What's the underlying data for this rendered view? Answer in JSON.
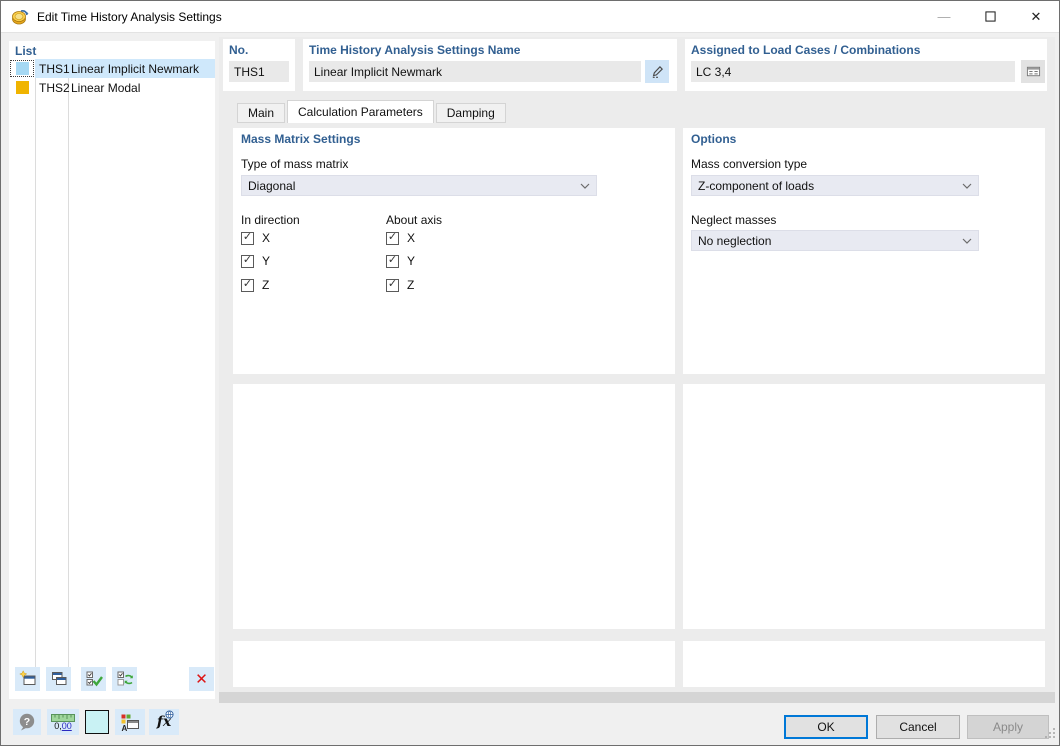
{
  "titlebar": {
    "title": "Edit Time History Analysis Settings",
    "minimize_icon": "—",
    "close_icon": "✕"
  },
  "list": {
    "header": "List",
    "items": [
      {
        "id": "THS1",
        "name": "Linear Implicit Newmark",
        "color": "#a5d8f3",
        "selected": true
      },
      {
        "id": "THS2",
        "name": "Linear Modal",
        "color": "#f0b400",
        "selected": false
      }
    ],
    "delete_icon": "✕"
  },
  "header_fields": {
    "no": {
      "label": "No.",
      "value": "THS1"
    },
    "name": {
      "label": "Time History Analysis Settings Name",
      "value": "Linear Implicit Newmark"
    },
    "assigned": {
      "label": "Assigned to Load Cases / Combinations",
      "value": "LC 3,4"
    }
  },
  "tabs": [
    {
      "label": "Main",
      "active": false
    },
    {
      "label": "Calculation Parameters",
      "active": true
    },
    {
      "label": "Damping",
      "active": false
    }
  ],
  "mass_matrix": {
    "header": "Mass Matrix Settings",
    "type_label": "Type of mass matrix",
    "type_value": "Diagonal",
    "in_direction": {
      "label": "In direction",
      "options": [
        {
          "label": "X",
          "checked": true
        },
        {
          "label": "Y",
          "checked": true
        },
        {
          "label": "Z",
          "checked": true
        }
      ]
    },
    "about_axis": {
      "label": "About axis",
      "options": [
        {
          "label": "X",
          "checked": true
        },
        {
          "label": "Y",
          "checked": true
        },
        {
          "label": "Z",
          "checked": true
        }
      ]
    }
  },
  "options_panel": {
    "header": "Options",
    "conversion_label": "Mass conversion type",
    "conversion_value": "Z-component of loads",
    "neglect_label": "Neglect masses",
    "neglect_value": "No neglection"
  },
  "footer": {
    "help_icon": "?",
    "decimal_prefix": "0,",
    "decimal_suffix": "00",
    "swatch_color": "#c9f2f4",
    "formula_icon": "fx",
    "ok": "OK",
    "cancel": "Cancel",
    "apply": "Apply"
  },
  "icons": {
    "check": "✓"
  },
  "colors": {
    "accent_blue": "#315f91",
    "selection": "#cfe8fb",
    "toolbar_button_bg": "#d9eaf9",
    "dropdown_bg": "#e8eaf2",
    "ok_focus_border": "#0078d7",
    "delete_red": "#dd1414"
  }
}
